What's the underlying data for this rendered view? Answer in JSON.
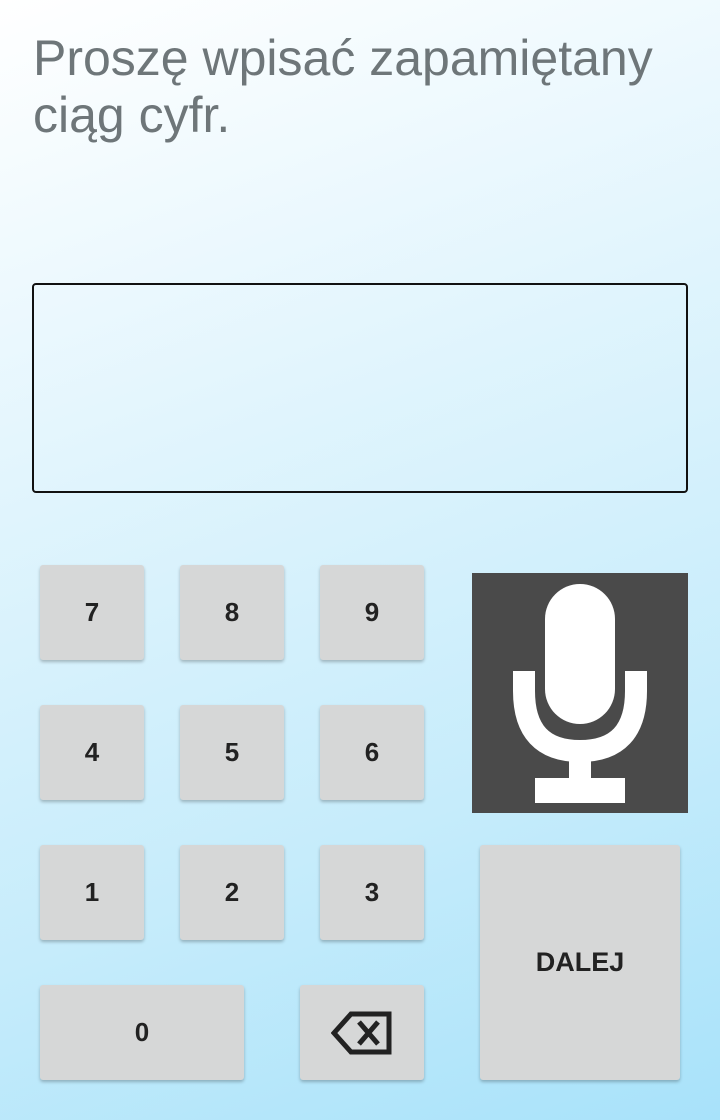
{
  "prompt": {
    "text": "Proszę wpisać zapamiętany ciąg cyfr."
  },
  "answer_field": {
    "value": "",
    "placeholder": ""
  },
  "keypad": {
    "key_7": "7",
    "key_8": "8",
    "key_9": "9",
    "key_4": "4",
    "key_5": "5",
    "key_6": "6",
    "key_1": "1",
    "key_2": "2",
    "key_3": "3",
    "key_0": "0",
    "backspace_icon": "backspace-icon",
    "microphone_icon": "microphone-icon",
    "next_label": "DALEJ"
  },
  "colors": {
    "key_background": "#d6d7d7",
    "mic_background": "#4a4a4a",
    "prompt_text": "#6e7679",
    "field_border": "#111111"
  }
}
